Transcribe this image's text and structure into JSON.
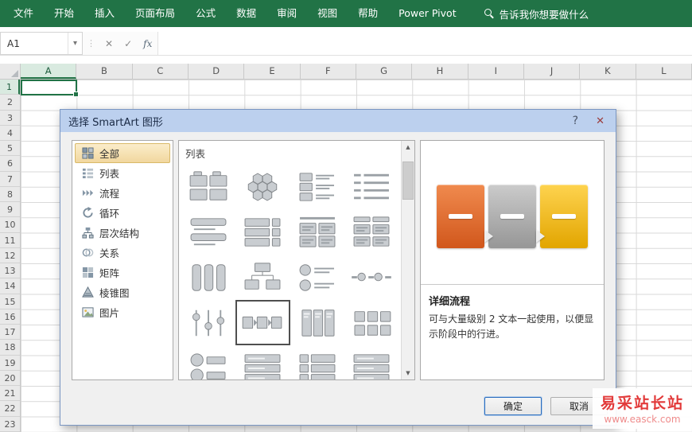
{
  "colors": {
    "excel_green": "#217346",
    "dialog_titlebar": "#bcd0ee",
    "selection_green": "#217346",
    "watermark_red": "#e23a3a"
  },
  "ribbon": {
    "tabs": [
      "文件",
      "开始",
      "插入",
      "页面布局",
      "公式",
      "数据",
      "审阅",
      "视图",
      "帮助",
      "Power Pivot"
    ],
    "search_label": "告诉我你想要做什么"
  },
  "formula_bar": {
    "name_box_value": "A1",
    "dropdown_icon": "▾",
    "dots_icon": "⋮",
    "cancel_icon": "✕",
    "enter_icon": "✓",
    "fx_label": "fx",
    "formula_value": ""
  },
  "sheet": {
    "columns": [
      "A",
      "B",
      "C",
      "D",
      "E",
      "F",
      "G",
      "H",
      "I",
      "J",
      "K",
      "L"
    ],
    "rows": [
      "1",
      "2",
      "3",
      "4",
      "5",
      "6",
      "7",
      "8",
      "9",
      "10",
      "11",
      "12",
      "13",
      "14",
      "15",
      "16",
      "17",
      "18",
      "19",
      "20",
      "21",
      "22",
      "23"
    ],
    "selected_cell": "A1"
  },
  "dialog": {
    "title": "选择 SmartArt 图形",
    "help_label": "?",
    "close_label": "✕",
    "categories": [
      {
        "label": "全部",
        "icon": "all-icon",
        "selected": true
      },
      {
        "label": "列表",
        "icon": "list-icon",
        "selected": false
      },
      {
        "label": "流程",
        "icon": "process-icon",
        "selected": false
      },
      {
        "label": "循环",
        "icon": "cycle-icon",
        "selected": false
      },
      {
        "label": "层次结构",
        "icon": "hierarchy-icon",
        "selected": false
      },
      {
        "label": "关系",
        "icon": "relationship-icon",
        "selected": false
      },
      {
        "label": "矩阵",
        "icon": "matrix-icon",
        "selected": false
      },
      {
        "label": "棱锥图",
        "icon": "pyramid-icon",
        "selected": false
      },
      {
        "label": "图片",
        "icon": "picture-icon",
        "selected": false
      }
    ],
    "gallery": {
      "group_label": "列表",
      "scroll_up_icon": "▲",
      "scroll_down_icon": "▼",
      "selected_index": 13,
      "thumbnails": [
        {
          "kind": "tab-grid"
        },
        {
          "kind": "hex"
        },
        {
          "kind": "box-lines"
        },
        {
          "kind": "line-dash"
        },
        {
          "kind": "wide-bars"
        },
        {
          "kind": "bar-box-rows"
        },
        {
          "kind": "two-col-lines"
        },
        {
          "kind": "two-col-lines2"
        },
        {
          "kind": "vert-cols"
        },
        {
          "kind": "hier"
        },
        {
          "kind": "circle-lines"
        },
        {
          "kind": "dash-circle"
        },
        {
          "kind": "slider-lines"
        },
        {
          "kind": "arrow-boxes"
        },
        {
          "kind": "tall-bars"
        },
        {
          "kind": "square-grid"
        },
        {
          "kind": "circle-stack"
        },
        {
          "kind": "row-lines"
        },
        {
          "kind": "row-boxes"
        },
        {
          "kind": "row-lines"
        }
      ]
    },
    "preview": {
      "title": "详细流程",
      "description": "可与大量级别 2 文本一起使用，以便显示阶段中的行进。",
      "blocks": [
        {
          "name": "orange-block",
          "top": "#f08a4e",
          "bottom": "#d1571c"
        },
        {
          "name": "gray-block",
          "top": "#cbcbcb",
          "bottom": "#969696"
        },
        {
          "name": "gold-block",
          "top": "#fed34f",
          "bottom": "#e2a500"
        }
      ]
    },
    "buttons": {
      "ok": "确定",
      "cancel": "取消"
    }
  },
  "watermark": {
    "title": "易采站长站",
    "url": "www.easck.com"
  }
}
